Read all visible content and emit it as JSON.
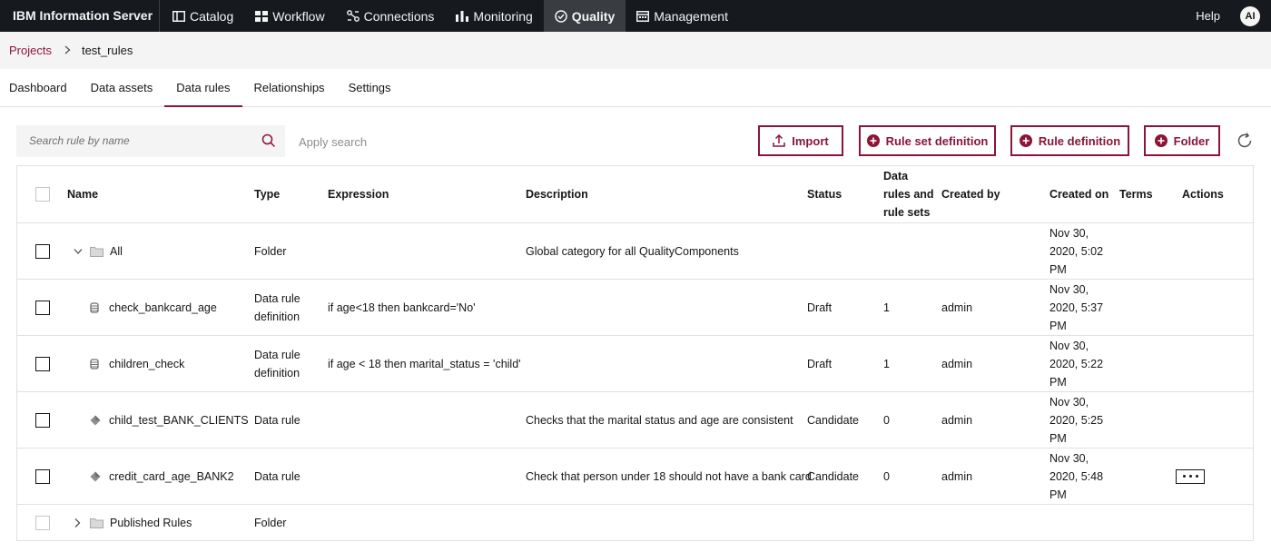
{
  "topbar": {
    "brand": "IBM Information Server",
    "nav": [
      {
        "label": "Catalog",
        "icon": "catalog-icon"
      },
      {
        "label": "Workflow",
        "icon": "workflow-icon"
      },
      {
        "label": "Connections",
        "icon": "connections-icon"
      },
      {
        "label": "Monitoring",
        "icon": "monitoring-icon"
      },
      {
        "label": "Quality",
        "icon": "quality-icon"
      },
      {
        "label": "Management",
        "icon": "management-icon"
      }
    ],
    "active_nav": "Quality",
    "help": "Help",
    "avatar": "AI"
  },
  "breadcrumb": {
    "root": "Projects",
    "current": "test_rules"
  },
  "tabs": [
    "Dashboard",
    "Data assets",
    "Data rules",
    "Relationships",
    "Settings"
  ],
  "active_tab": "Data rules",
  "search": {
    "placeholder": "Search rule by name",
    "apply_label": "Apply search"
  },
  "toolbar": {
    "import_label": "Import",
    "rule_set_label": "Rule set definition",
    "rule_def_label": "Rule definition",
    "folder_label": "Folder"
  },
  "table": {
    "headers": {
      "name": "Name",
      "type": "Type",
      "expression": "Expression",
      "description": "Description",
      "status": "Status",
      "count_line1": "Data",
      "count_line2": "rules and",
      "count_line3": "rule sets",
      "created_by": "Created by",
      "created_on": "Created on",
      "terms": "Terms",
      "actions": "Actions"
    },
    "rows": [
      {
        "name": "All",
        "type1": "Folder",
        "type2": "",
        "expression": "",
        "description": "Global category for all QualityComponents",
        "status": "",
        "count": "",
        "created_by": "",
        "date1": "Nov 30,",
        "date2": "2020, 5:02",
        "date3": "PM"
      },
      {
        "name": "check_bankcard_age",
        "type1": "Data rule",
        "type2": "definition",
        "expression": "if age<18 then bankcard='No'",
        "description": "",
        "status": "Draft",
        "count": "1",
        "created_by": "admin",
        "date1": "Nov 30,",
        "date2": "2020, 5:37",
        "date3": "PM"
      },
      {
        "name": "children_check",
        "type1": "Data rule",
        "type2": "definition",
        "expression": "if age < 18 then marital_status = 'child'",
        "description": "",
        "status": "Draft",
        "count": "1",
        "created_by": "admin",
        "date1": "Nov 30,",
        "date2": "2020, 5:22",
        "date3": "PM"
      },
      {
        "name": "child_test_BANK_CLIENTS",
        "type1": "Data rule",
        "type2": "",
        "expression": "",
        "description": "Checks that the marital status and age are consistent",
        "status": "Candidate",
        "count": "0",
        "created_by": "admin",
        "date1": "Nov 30,",
        "date2": "2020, 5:25",
        "date3": "PM"
      },
      {
        "name": "credit_card_age_BANK2",
        "type1": "Data rule",
        "type2": "",
        "expression": "",
        "description": "Check that person under 18 should not have a bank card",
        "status": "Candidate",
        "count": "0",
        "created_by": "admin",
        "date1": "Nov 30,",
        "date2": "2020, 5:48",
        "date3": "PM"
      },
      {
        "name": "Published Rules",
        "type1": "Folder",
        "type2": "",
        "expression": "",
        "description": "",
        "status": "",
        "count": "",
        "created_by": "",
        "date1": "",
        "date2": "",
        "date3": ""
      }
    ]
  },
  "colors": {
    "accent": "#8a1538",
    "topbar_bg": "#161a1f",
    "subtle_bg": "#f4f4f4"
  }
}
